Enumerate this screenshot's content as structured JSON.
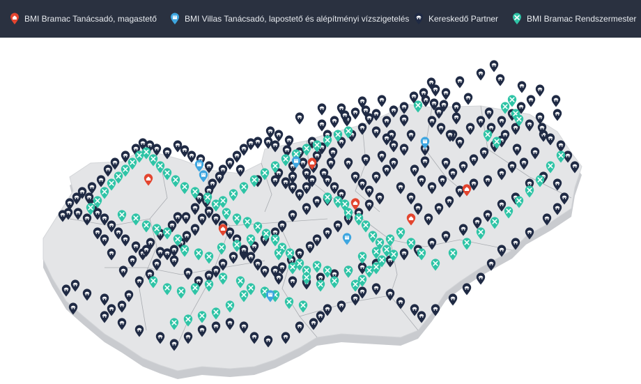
{
  "legend": {
    "items": [
      {
        "label": "BMI Bramac Tanácsadó, magastető",
        "icon": "house-pin-icon",
        "color": "#e3452f"
      },
      {
        "label": "BMI Villas Tanácsadó, lapostető és alépítményi vízszigetelés",
        "icon": "building-pin-icon",
        "color": "#3ea6e0"
      },
      {
        "label": "Kereskedő Partner",
        "icon": "dealer-pin-icon",
        "color": "#1f2a44"
      },
      {
        "label": "BMI Bramac Rendszermester",
        "icon": "tools-pin-icon",
        "color": "#2ec4a6"
      }
    ]
  },
  "map": {
    "region": "Hungary",
    "land_color": "#e4e5e7",
    "edge_color": "#bfc1c5",
    "border_color": "#9a9da2"
  }
}
